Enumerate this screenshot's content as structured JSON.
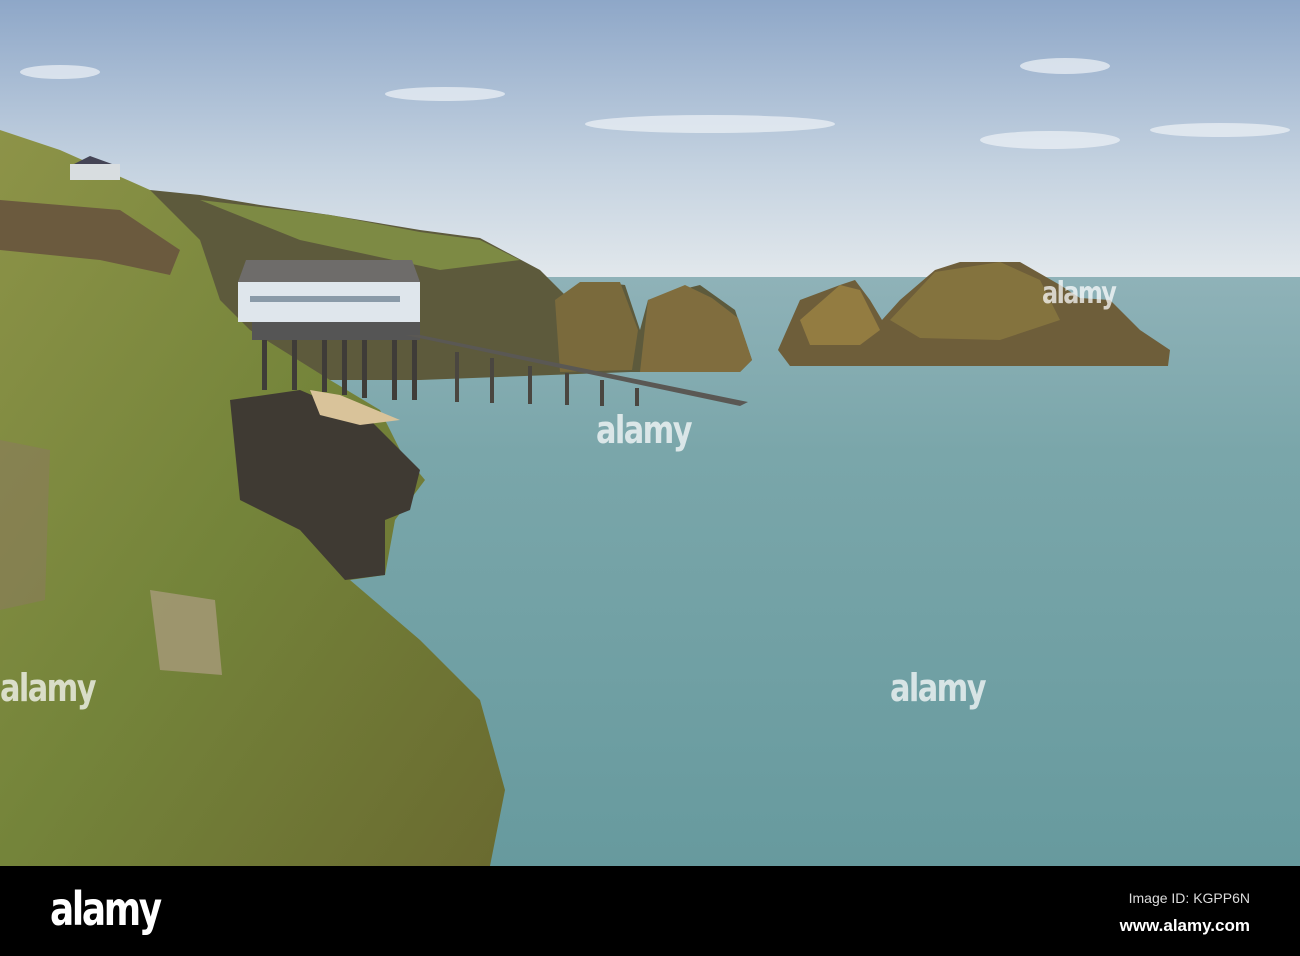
{
  "photo": {
    "subject": "lifeboat station on stilts with slipway beside rocky sea stacks and grassy cliff",
    "colors": {
      "sky_top": "#8fa8c8",
      "sky_horizon": "#dfe6ec",
      "sea": "#76a3a6",
      "grass": "#7e8a3c",
      "rock": "#5a5040"
    }
  },
  "watermarks": [
    "alamy",
    "alamy",
    "alamy",
    "alamy"
  ],
  "footer": {
    "logo": "alamy",
    "image_id": "Image ID: KGPP6N",
    "url": "www.alamy.com"
  }
}
